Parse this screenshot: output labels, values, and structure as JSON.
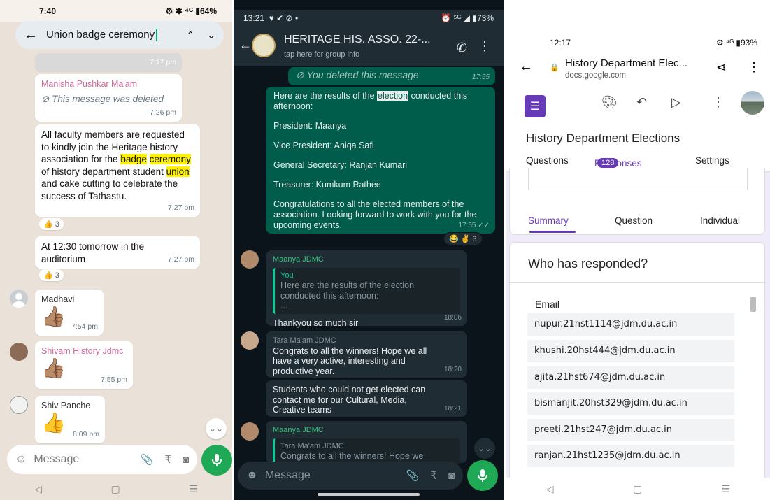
{
  "phone1": {
    "status": {
      "time": "7:40",
      "icons": "⚙ ✱ ⁴ᴳ ▮64%"
    },
    "search": {
      "query": "Union badge ceremony",
      "back": "←",
      "up": "⌃",
      "down": "⌄"
    },
    "top_time": "7:17 pm",
    "msg_deleted": {
      "sender": "Manisha Pushkar Ma'am",
      "text": "This message was deleted",
      "time": "7:26 pm"
    },
    "msg_main": {
      "part1": "All faculty members are requested to kindly join the Heritage history association for the ",
      "hl1": "badge",
      "hl2": "ceremony",
      "part2": " of history department student ",
      "hl3": "union",
      "part3": " and cake cutting to celebrate the success of Tathastu.",
      "time": "7:27 pm",
      "reaction": "👍 3"
    },
    "msg_meeting": {
      "text": "At 12:30 tomorrow in the auditorium",
      "time": "7:27 pm",
      "reaction": "👍 3"
    },
    "msg_madhavi": {
      "sender": "Madhavi",
      "emoji": "👍🏽",
      "time": "7:54 pm"
    },
    "msg_shivam": {
      "sender": "Shivam History Jdmc",
      "emoji": "👍🏽",
      "time": "7:55 pm"
    },
    "msg_shiv": {
      "sender": "Shiv Panche",
      "emoji": "👍",
      "time": "8:09 pm"
    },
    "composer": {
      "placeholder": "Message"
    },
    "nav": {
      "back": "◁",
      "home": "▢",
      "menu": "☰"
    }
  },
  "phone2": {
    "status": {
      "time": "13:21",
      "icons": "♥ ✔ ⊘ •",
      "right": "⏰ ⁵ᴳ ◢ ▮73%"
    },
    "header": {
      "title": "HERITAGE HIS. ASSO. 22-...",
      "subtitle": "tap here for group info"
    },
    "deleted": {
      "text": "You deleted this message",
      "time": "17:55"
    },
    "results": {
      "intro_a": "Here are the results of the ",
      "intro_hl": "election",
      "intro_b": " conducted this afternoon:",
      "president": "President: Maanya",
      "vp": "Vice President: Aniqa Safi",
      "gs": "General Secretary: Ranjan Kumari",
      "treasurer": "Treasurer: Kumkum Rathee",
      "congrats": "Congratulations to all the elected members of the association. Looking forward to work with you for the upcoming events.",
      "time": "17:55 ✓✓",
      "reaction": "😂 ✌ 3"
    },
    "reply1": {
      "sender": "Maanya JDMC",
      "quote_name": "You",
      "quote_text": "Here are the results of the election conducted this afternoon:",
      "quote_more": "...",
      "text": "Thankyou so much sir",
      "time": "18:06"
    },
    "tara1": {
      "sender": "Tara Ma'am JDMC",
      "text": "Congrats to all the winners! Hope we all have a very active, interesting and productive year.",
      "time": "18:20"
    },
    "tara2": {
      "text": "Students who could not get elected can contact me for our Cultural, Media, Creative teams",
      "time": "18:21"
    },
    "reply2": {
      "sender": "Maanya JDMC",
      "quote_name": "Tara Ma'am JDMC",
      "quote_text": "Congrats to all the winners! Hope we"
    },
    "composer": {
      "placeholder": "Message"
    }
  },
  "phone3": {
    "status": {
      "time": "12:17",
      "icons": "⚙ ⁴ᴳ ▮93%"
    },
    "address": {
      "title": "History Department Elec...",
      "url": "docs.google.com"
    },
    "form_title": "History Department Elections",
    "tabs": {
      "questions": "Questions",
      "responses": "Responses",
      "count": "128",
      "settings": "Settings"
    },
    "subtabs": {
      "summary": "Summary",
      "question": "Question",
      "individual": "Individual"
    },
    "who": "Who has responded?",
    "email_header": "Email",
    "emails": [
      "nupur.21hst1114@jdm.du.ac.in",
      "khushi.20hst444@jdm.du.ac.in",
      "ajita.21hst674@jdm.du.ac.in",
      "bismanjit.20hst329@jdm.du.ac.in",
      "preeti.21hst247@jdm.du.ac.in",
      "ranjan.21hst1235@jdm.du.ac.in"
    ]
  }
}
